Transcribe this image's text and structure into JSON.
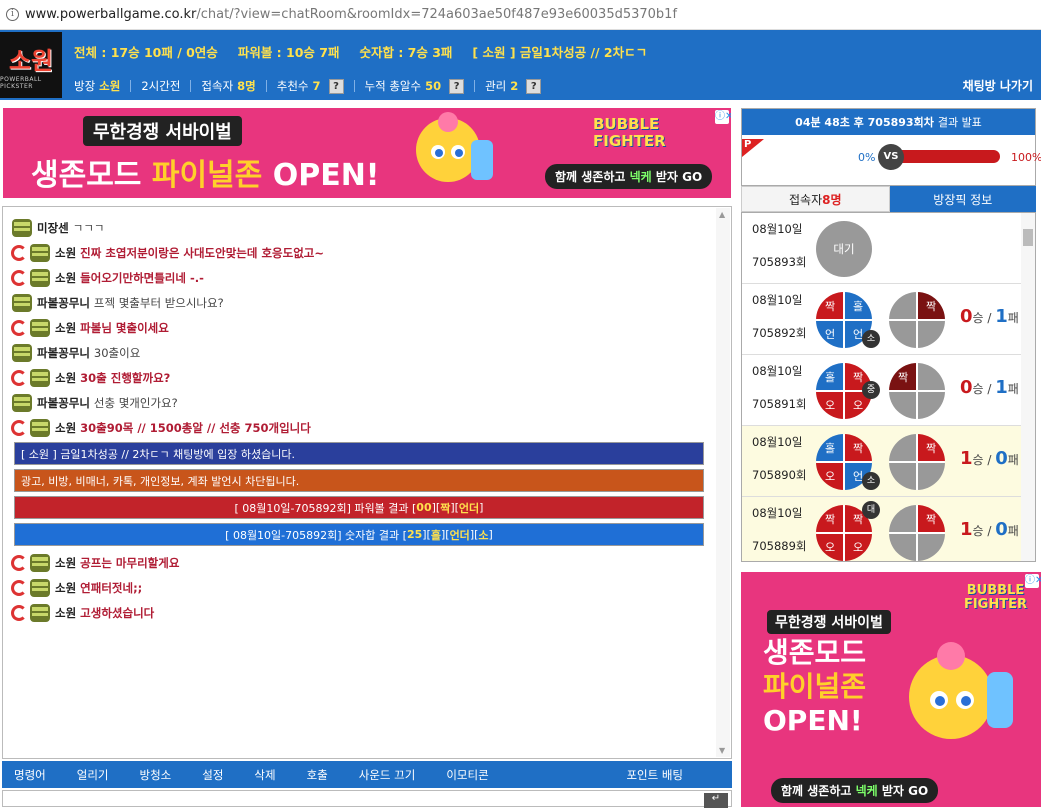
{
  "browser": {
    "host": "www.powerballgame.co.kr",
    "path": "/chat/?view=chatRoom&roomIdx=724a603ae50f487e93e60035d5370b1f"
  },
  "header": {
    "logo_text": "소원",
    "logo_sub": "POWERBALL PICKSTER",
    "stats": [
      "전체 : 17승 10패 / 0연승",
      "파워볼 : 10승 7패",
      "숫자합 : 7승 3패",
      "[ 소원 ] 금일1차성공 // 2차ㄷㄱ"
    ],
    "info": {
      "host_label": "방장",
      "host_name": "소원",
      "duration": "2시간전",
      "users_label": "접속자",
      "users_val": "8명",
      "rec_label": "추천수",
      "rec_val": "7",
      "total_label": "누적 총알수",
      "total_val": "50",
      "admin_label": "관리",
      "admin_val": "2"
    },
    "exit_label": "채팅방 나가기",
    "help_glyph": "?"
  },
  "ads": {
    "top": {
      "line1": "무한경쟁 서바이벌",
      "line2a": "생존모드 ",
      "line2b": "파이널존",
      "line2c": " OPEN!",
      "brand1": "BUBBLE",
      "brand2": "FIGHTER",
      "cta_a": "함께 생존하고 ",
      "cta_b": "넥케",
      "cta_c": " 받자 GO"
    },
    "side": {
      "line1": "무한경쟁 서바이벌",
      "line2": "생존모드",
      "line3": "파이널존",
      "line4": "OPEN!",
      "brand1": "BUBBLE",
      "brand2": "FIGHTER",
      "cta_a": "함께 생존하고 ",
      "cta_b": "넥케",
      "cta_c": " 받자 GO"
    },
    "close_glyph": "ⓘ✕"
  },
  "chat": [
    {
      "nick": "미장센",
      "text": "ㄱㄱㄱ",
      "red": false,
      "swirl": false
    },
    {
      "nick": "소원",
      "text": "진짜 초엽저분이랑은 사대도안맞는데 호응도없고~",
      "red": true,
      "swirl": true
    },
    {
      "nick": "소원",
      "text": "들어오기만하면틀리네 -.-",
      "red": true,
      "swirl": true
    },
    {
      "nick": "파볼꽁무니",
      "text": "프젝 몇출부터 받으시나요?",
      "red": false,
      "swirl": false
    },
    {
      "nick": "소원",
      "text": "파볼님 몇출이세요",
      "red": true,
      "swirl": true
    },
    {
      "nick": "파볼꽁무니",
      "text": "30출이요",
      "red": false,
      "swirl": false
    },
    {
      "nick": "소원",
      "text": "30출 진행할까요?",
      "red": true,
      "swirl": true
    },
    {
      "nick": "파볼꽁무니",
      "text": "선충 몇개인가요?",
      "red": false,
      "swirl": false
    },
    {
      "nick": "소원",
      "text": "30출90목 // 1500총알 // 선충 750개입니다",
      "red": true,
      "swirl": true
    }
  ],
  "system": {
    "enter": "[ 소원 ] 금일1차성공 // 2차ㄷㄱ  채팅방에 입장 하셨습니다.",
    "warn": "광고, 비방, 비매너, 카톡, 개인정보, 계좌 발언시 차단됩니다.",
    "pb_prefix": "[ 08월10일-705892회]  파워볼 결과 [",
    "pb_v1": "00",
    "pb_mid1": "][",
    "pb_v2": "짝",
    "pb_mid2": "][",
    "pb_v3": "언더",
    "pb_end": "]",
    "ns_prefix": "[ 08월10일-705892회]  숫자합 결과 [",
    "ns_v1": "25",
    "ns_mid1": "][",
    "ns_v2": "홀",
    "ns_mid2": "][",
    "ns_v3": "언더",
    "ns_mid3": "][",
    "ns_v4": "소",
    "ns_end": "]"
  },
  "chat2": [
    {
      "nick": "소원",
      "text": "공프는 마무리할게요"
    },
    {
      "nick": "소원",
      "text": "연패터젓네;;"
    },
    {
      "nick": "소원",
      "text": "고생하셨습니다"
    }
  ],
  "toolbar": [
    "명령어",
    "얼리기",
    "방청소",
    "설정",
    "삭제",
    "호출",
    "사운드 끄기",
    "이모티콘"
  ],
  "point_bet": "포인트 배팅",
  "send_icon": "↵",
  "timer": {
    "text_a": "04분 48초 후",
    "text_b": "705893회차",
    "text_c": "결과 발표",
    "p_flag": "P",
    "pct_left": "0%",
    "vs": "VS",
    "pct_right": "100%",
    "red_ratio": 1.0
  },
  "tabs": {
    "users_a": "접속자 ",
    "users_b": "8명",
    "pick": "방장픽 정보"
  },
  "rounds": [
    {
      "date": "08월10일",
      "no": "705893회",
      "wait": "대기"
    },
    {
      "date": "08월10일",
      "no": "705892회",
      "q1": [
        "짝",
        "홀",
        "언",
        "언"
      ],
      "c1": [
        "R",
        "B",
        "B",
        "B"
      ],
      "badge1": "소",
      "q2": [
        "",
        "짝",
        "",
        ""
      ],
      "c2": [
        "G",
        "D",
        "G",
        "G"
      ],
      "w": "0",
      "wl": "승",
      "l": "1",
      "ll": "패",
      "win": false
    },
    {
      "date": "08월10일",
      "no": "705891회",
      "q1": [
        "홀",
        "짝",
        "오",
        "오"
      ],
      "c1": [
        "B",
        "R",
        "R",
        "R"
      ],
      "badge1": "중",
      "q2": [
        "짝",
        "",
        "",
        ""
      ],
      "c2": [
        "D",
        "G",
        "G",
        "G"
      ],
      "w": "0",
      "wl": "승",
      "l": "1",
      "ll": "패",
      "win": false
    },
    {
      "date": "08월10일",
      "no": "705890회",
      "q1": [
        "홀",
        "짝",
        "오",
        "언"
      ],
      "c1": [
        "B",
        "R",
        "R",
        "B"
      ],
      "badge1": "소",
      "q2": [
        "",
        "짝",
        "",
        ""
      ],
      "c2": [
        "G",
        "R",
        "G",
        "G"
      ],
      "w": "1",
      "wl": "승",
      "l": "0",
      "ll": "패",
      "win": true
    },
    {
      "date": "08월10일",
      "no": "705889회",
      "q1": [
        "짝",
        "짝",
        "오",
        "오"
      ],
      "c1": [
        "R",
        "R",
        "R",
        "R"
      ],
      "badge1": "대",
      "q2": [
        "",
        "짝",
        "",
        ""
      ],
      "c2": [
        "G",
        "R",
        "G",
        "G"
      ],
      "w": "1",
      "wl": "승",
      "l": "0",
      "ll": "패",
      "win": true
    }
  ],
  "score_sep": " / "
}
